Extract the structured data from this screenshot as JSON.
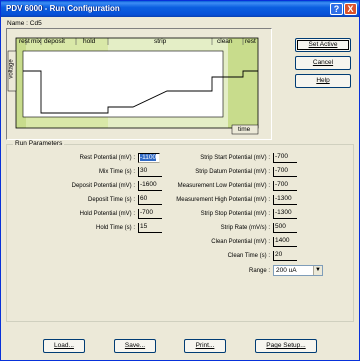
{
  "window": {
    "title": "PDV 6000 - Run Configuration",
    "help_glyph": "?",
    "close_glyph": "X"
  },
  "name_line": "Name : Cd5",
  "graph": {
    "phases": [
      "rest",
      "mix",
      "deposit",
      "hold",
      "strip",
      "clean",
      "rest"
    ],
    "y_axis_label": "voltage",
    "x_axis_label": "time"
  },
  "side_buttons": {
    "set_active": "Set Active",
    "cancel": "Cancel",
    "help": "Help"
  },
  "run_parameters": {
    "title": "Run Parameters",
    "left": [
      {
        "label": "Rest Potential (mV) :",
        "value": "-1100",
        "selected": true
      },
      {
        "label": "Mix Time (s) :",
        "value": "30"
      },
      {
        "label": "Deposit Potential (mV) :",
        "value": "-1600"
      },
      {
        "label": "Deposit Time (s) :",
        "value": "60"
      },
      {
        "label": "Hold Potential (mV) :",
        "value": "-700"
      },
      {
        "label": "Hold Time (s) :",
        "value": "15"
      }
    ],
    "right": [
      {
        "label": "Strip Start Potential (mV) :",
        "value": "-700"
      },
      {
        "label": "Strip Datum Potential (mV) :",
        "value": "-700"
      },
      {
        "label": "Measurement Low Potential (mV) :",
        "value": "-700"
      },
      {
        "label": "Measurement High Potential (mV) :",
        "value": "-1300"
      },
      {
        "label": "Strip Stop Potential (mV) :",
        "value": "-1300"
      },
      {
        "label": "Strip Rate (mV/s) :",
        "value": "500"
      },
      {
        "label": "Clean Potential (mV) :",
        "value": "1400"
      },
      {
        "label": "Clean Time (s) :",
        "value": "20"
      }
    ],
    "range": {
      "label": "Range :",
      "value": "200 uA"
    }
  },
  "bottom_buttons": {
    "load": "Load...",
    "save": "Save...",
    "print": "Print...",
    "page_setup": "Page Setup..."
  }
}
